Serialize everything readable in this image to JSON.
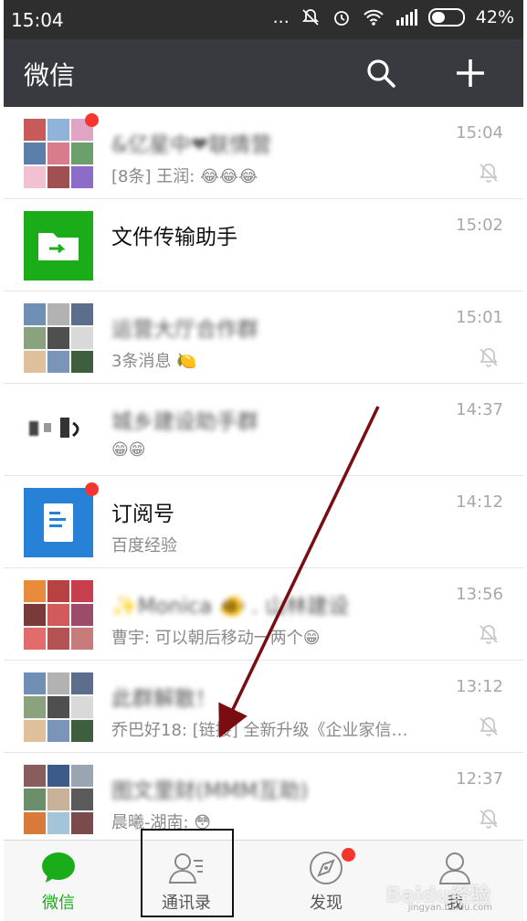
{
  "status": {
    "time": "15:04",
    "icons_text": "...",
    "battery_percent": "42%"
  },
  "appbar": {
    "title": "微信"
  },
  "colors": {
    "accent": "#1aad19",
    "unread": "#f43530",
    "appbar": "#393a3f"
  },
  "chats": [
    {
      "name": "&亿星中❤联情营",
      "time": "15:04",
      "msg": "[8条] 王润: 😂😂😂",
      "unread": true,
      "muted": true,
      "avatar": "group"
    },
    {
      "name": "文件传输助手",
      "time": "15:02",
      "msg": "",
      "unread": false,
      "muted": false,
      "avatar": "file"
    },
    {
      "name": "运营大厅合作群",
      "time": "15:01",
      "msg": "3条消息 🍋",
      "unread": false,
      "muted": true,
      "avatar": "group"
    },
    {
      "name": "城乡建设助手群",
      "time": "14:37",
      "msg": "😁😁",
      "unread": false,
      "muted": false,
      "avatar": "pixel"
    },
    {
      "name": "订阅号",
      "time": "14:12",
      "msg": "百度经验",
      "unread": true,
      "muted": false,
      "avatar": "subscription"
    },
    {
      "name": "✨Monica 🐠 . 山林建设",
      "time": "13:56",
      "msg": "曹宇: 可以朝后移动一两个😁",
      "unread": false,
      "muted": true,
      "avatar": "group"
    },
    {
      "name": "此群解散！",
      "time": "13:12",
      "msg": "乔巴好18: [链接] 全新升级《企业家信…",
      "unread": false,
      "muted": true,
      "avatar": "group"
    },
    {
      "name": "图文里财(MMM互助)",
      "time": "12:37",
      "msg": "晨曦-湖南: 😳",
      "unread": false,
      "muted": true,
      "avatar": "group"
    }
  ],
  "tabs": [
    {
      "label": "微信",
      "icon": "chat-bubble-icon",
      "active": true
    },
    {
      "label": "通讯录",
      "icon": "contacts-icon",
      "active": false
    },
    {
      "label": "发现",
      "icon": "compass-icon",
      "active": false,
      "badge": true
    },
    {
      "label": "我",
      "icon": "person-icon",
      "active": false
    }
  ],
  "watermark": {
    "text": "Baidu经验",
    "sub": "jingyan.baidu.com"
  }
}
